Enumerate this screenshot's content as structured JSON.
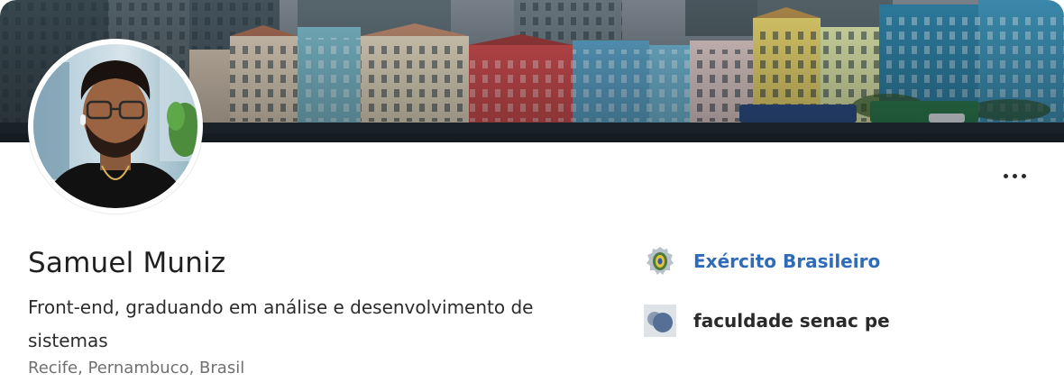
{
  "profile": {
    "name": "Samuel Muniz",
    "headline": "Front-end, graduando em análise e desenvolvimento de sistemas",
    "location": "Recife, Pernambuco, Brasil"
  },
  "experience": [
    {
      "name": "Exército Brasileiro",
      "icon": "army-emblem-icon"
    },
    {
      "name": "faculdade senac pe",
      "icon": "college-logo-icon"
    }
  ],
  "actions": {
    "more_icon": "more-horizontal-icon"
  },
  "colors": {
    "link": "#2f6bb8",
    "text": "#1f1f1f",
    "muted": "#707070"
  }
}
